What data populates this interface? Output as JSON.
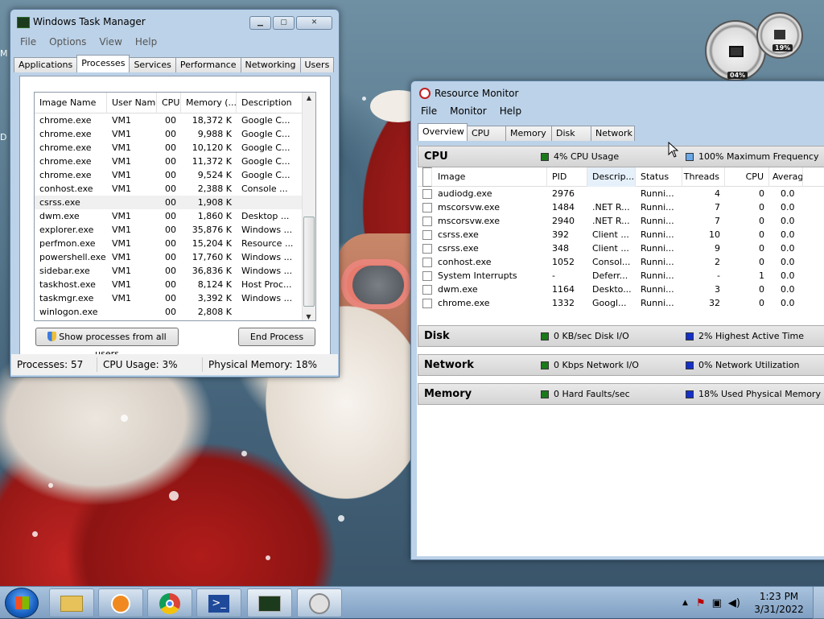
{
  "desktop": {
    "edge_letters": [
      "M",
      "D"
    ]
  },
  "task_manager": {
    "title": "Windows Task Manager",
    "menu": [
      "File",
      "Options",
      "View",
      "Help"
    ],
    "tabs": [
      "Applications",
      "Processes",
      "Services",
      "Performance",
      "Networking",
      "Users"
    ],
    "active_tab": "Processes",
    "columns": [
      "Image Name",
      "User Name",
      "CPU",
      "Memory (...",
      "Description"
    ],
    "rows": [
      [
        "chrome.exe",
        "VM1",
        "00",
        "18,372 K",
        "Google C..."
      ],
      [
        "chrome.exe",
        "VM1",
        "00",
        "9,988 K",
        "Google C..."
      ],
      [
        "chrome.exe",
        "VM1",
        "00",
        "10,120 K",
        "Google C..."
      ],
      [
        "chrome.exe",
        "VM1",
        "00",
        "11,372 K",
        "Google C..."
      ],
      [
        "chrome.exe",
        "VM1",
        "00",
        "9,524 K",
        "Google C..."
      ],
      [
        "conhost.exe",
        "VM1",
        "00",
        "2,388 K",
        "Console ..."
      ],
      [
        "csrss.exe",
        "",
        "00",
        "1,908 K",
        ""
      ],
      [
        "dwm.exe",
        "VM1",
        "00",
        "1,860 K",
        "Desktop ..."
      ],
      [
        "explorer.exe",
        "VM1",
        "00",
        "35,876 K",
        "Windows ..."
      ],
      [
        "perfmon.exe",
        "VM1",
        "00",
        "15,204 K",
        "Resource ..."
      ],
      [
        "powershell.exe",
        "VM1",
        "00",
        "17,760 K",
        "Windows ..."
      ],
      [
        "sidebar.exe",
        "VM1",
        "00",
        "36,836 K",
        "Windows ..."
      ],
      [
        "taskhost.exe",
        "VM1",
        "00",
        "8,124 K",
        "Host Proc..."
      ],
      [
        "taskmgr.exe",
        "VM1",
        "00",
        "3,392 K",
        "Windows ..."
      ],
      [
        "winlogon.exe",
        "",
        "00",
        "2,808 K",
        ""
      ]
    ],
    "selected_row": 6,
    "show_all_label": "Show processes from all users",
    "end_process_label": "End Process",
    "status": {
      "processes": "Processes: 57",
      "cpu": "CPU Usage: 3%",
      "memory": "Physical Memory: 18%"
    }
  },
  "resource_monitor": {
    "title": "Resource Monitor",
    "menu": [
      "File",
      "Monitor",
      "Help"
    ],
    "tabs": [
      "Overview",
      "CPU",
      "Memory",
      "Disk",
      "Network"
    ],
    "active_tab": "Overview",
    "cpu": {
      "name": "CPU",
      "ind1": "4% CPU Usage",
      "ind2": "100% Maximum Frequency",
      "color1": "#1a7a1a",
      "color2": "#6aa8e8"
    },
    "columns": [
      "Image",
      "PID",
      "Descrip...",
      "Status",
      "Threads",
      "CPU",
      "Averag"
    ],
    "rows": [
      [
        "audiodg.exe",
        "2976",
        "",
        "Runni...",
        "4",
        "0",
        "0.0"
      ],
      [
        "mscorsvw.exe",
        "1484",
        ".NET R...",
        "Runni...",
        "7",
        "0",
        "0.0"
      ],
      [
        "mscorsvw.exe",
        "2940",
        ".NET R...",
        "Runni...",
        "7",
        "0",
        "0.0"
      ],
      [
        "csrss.exe",
        "392",
        "Client ...",
        "Runni...",
        "10",
        "0",
        "0.0"
      ],
      [
        "csrss.exe",
        "348",
        "Client ...",
        "Runni...",
        "9",
        "0",
        "0.0"
      ],
      [
        "conhost.exe",
        "1052",
        "Consol...",
        "Runni...",
        "2",
        "0",
        "0.0"
      ],
      [
        "System Interrupts",
        "-",
        "Deferr...",
        "Runni...",
        "-",
        "1",
        "0.0"
      ],
      [
        "dwm.exe",
        "1164",
        "Deskto...",
        "Runni...",
        "3",
        "0",
        "0.0"
      ],
      [
        "chrome.exe",
        "1332",
        "Googl...",
        "Runni...",
        "32",
        "0",
        "0.0"
      ]
    ],
    "disk": {
      "name": "Disk",
      "ind1": "0 KB/sec Disk I/O",
      "ind2": "2% Highest Active Time"
    },
    "network": {
      "name": "Network",
      "ind1": "0 Kbps Network I/O",
      "ind2": "0% Network Utilization"
    },
    "memory": {
      "name": "Memory",
      "ind1": "0 Hard Faults/sec",
      "ind2": "18% Used Physical Memory"
    },
    "green": "#1a7a1a",
    "blue": "#1530c8"
  },
  "gadget": {
    "cpu_value": "04%",
    "mem_value": "19%"
  },
  "taskbar": {
    "time": "1:23 PM",
    "date": "3/31/2022",
    "pinned": [
      "explorer-icon",
      "media-player-icon",
      "chrome-icon",
      "powershell-icon",
      "task-manager-icon",
      "resource-monitor-icon"
    ]
  }
}
